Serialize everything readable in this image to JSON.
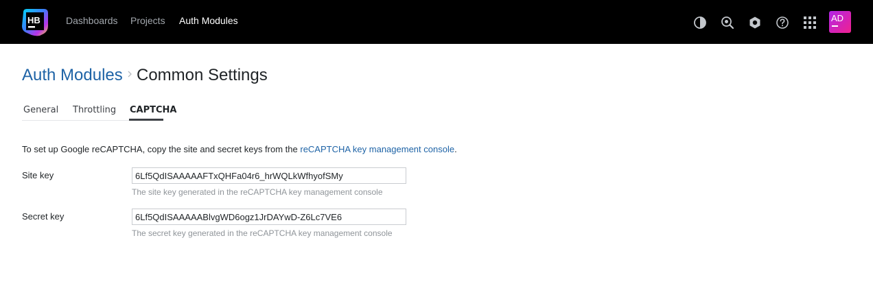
{
  "header": {
    "logo_text": "HB",
    "nav": [
      {
        "label": "Dashboards",
        "active": false
      },
      {
        "label": "Projects",
        "active": false
      },
      {
        "label": "Auth Modules",
        "active": true
      }
    ],
    "icons": [
      "theme-toggle-icon",
      "search-icon",
      "admin-settings-icon",
      "help-icon",
      "apps-grid-icon"
    ],
    "avatar": {
      "initials": "AD",
      "gradient": [
        "#b125e8",
        "#f0218f"
      ]
    }
  },
  "breadcrumb": {
    "parent": "Auth Modules",
    "current": "Common Settings"
  },
  "tabs": [
    {
      "label": "General",
      "active": false
    },
    {
      "label": "Throttling",
      "active": false
    },
    {
      "label": "CAPTCHA",
      "active": true
    }
  ],
  "intro": {
    "text": "To set up Google reCAPTCHA, copy the site and secret keys from the ",
    "link": "reCAPTCHA key management console",
    "suffix": "."
  },
  "form": {
    "site_key": {
      "label": "Site key",
      "value": "6Lf5QdISAAAAAFTxQHFa04r6_hrWQLkWfhyofSMy",
      "hint": "The site key generated in the reCAPTCHA key management console"
    },
    "secret_key": {
      "label": "Secret key",
      "value": "6Lf5QdISAAAAABlvgWD6ogz1JrDAYwD-Z6Lc7VE6",
      "hint": "The secret key generated in the reCAPTCHA key management console"
    }
  },
  "colors": {
    "header_bg": "#000000",
    "link": "#1e63a6",
    "nav_inactive": "#a3a8ae"
  }
}
